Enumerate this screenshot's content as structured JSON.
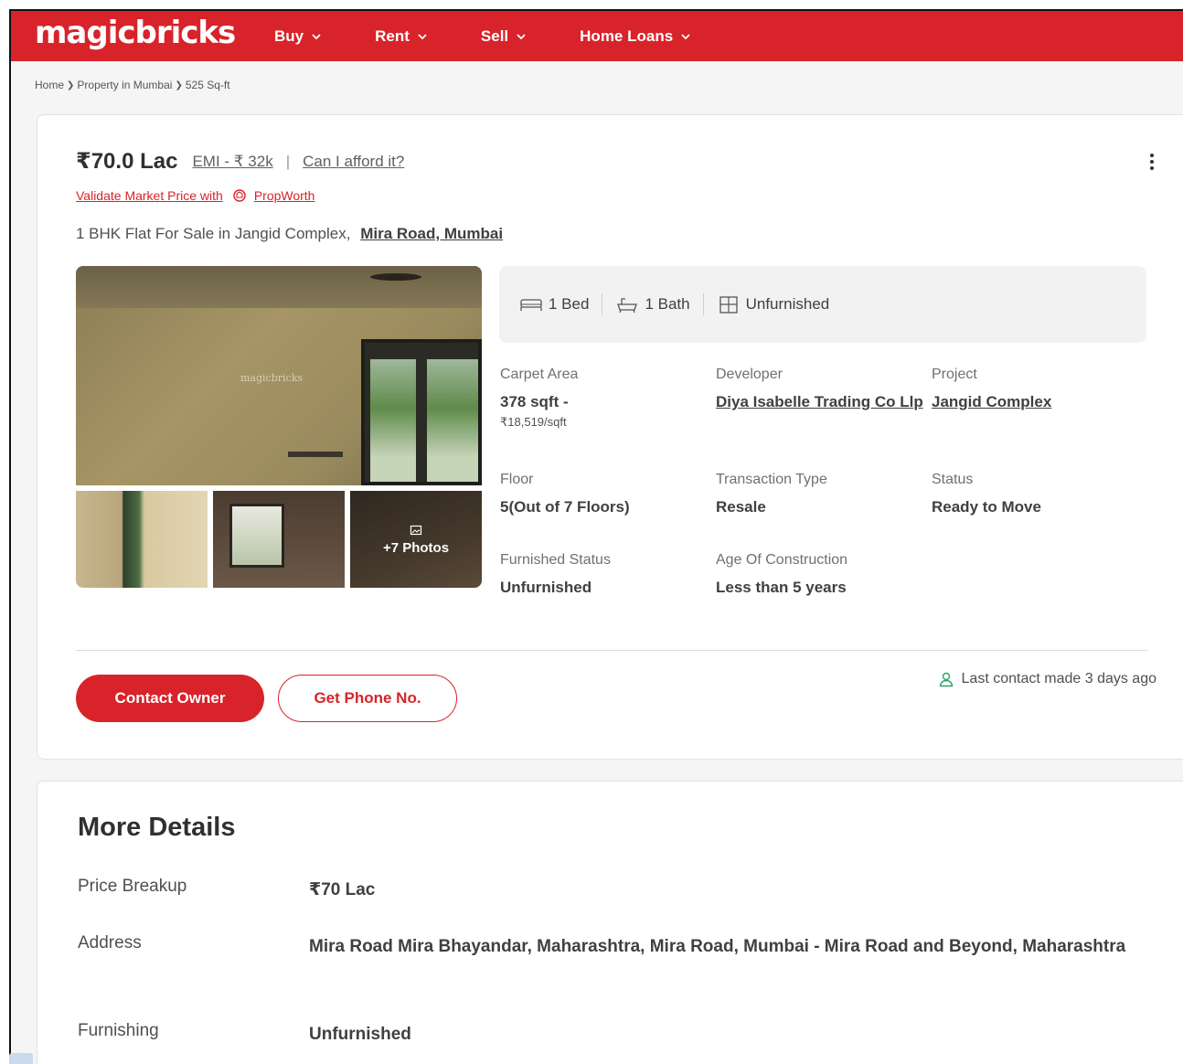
{
  "header": {
    "logo": "magicbricks",
    "nav": [
      {
        "label": "Buy"
      },
      {
        "label": "Rent"
      },
      {
        "label": "Sell"
      },
      {
        "label": "Home Loans"
      }
    ]
  },
  "breadcrumb": {
    "items": [
      "Home",
      "Property in Mumbai",
      "525 Sq-ft"
    ]
  },
  "listing": {
    "price": "₹70.0 Lac",
    "emi": "EMI - ₹ 32k",
    "afford": "Can I afford it?",
    "validate_text": "Validate Market Price with",
    "propworth": "PropWorth",
    "title": "1 BHK Flat For Sale in Jangid Complex,",
    "location": "Mira Road, Mumbai",
    "watermark": "magicbricks",
    "more_photos": "+7 Photos",
    "summary": {
      "bed": "1 Bed",
      "bath": "1 Bath",
      "furnishing": "Unfurnished"
    },
    "details": {
      "carpet_label": "Carpet Area",
      "carpet_value": "378 sqft -",
      "carpet_rate": "₹18,519/sqft",
      "developer_label": "Developer",
      "developer_value": "Diya Isabelle Trading Co Llp",
      "project_label": "Project",
      "project_value": "Jangid Complex",
      "floor_label": "Floor",
      "floor_value": "5(Out of 7 Floors)",
      "transaction_label": "Transaction Type",
      "transaction_value": "Resale",
      "status_label": "Status",
      "status_value": "Ready to Move",
      "furnished_label": "Furnished Status",
      "furnished_value": "Unfurnished",
      "age_label": "Age Of Construction",
      "age_value": "Less than 5 years"
    },
    "contact_button": "Contact Owner",
    "phone_button": "Get Phone No.",
    "last_contact": "Last contact made 3 days ago"
  },
  "more_details": {
    "title": "More Details",
    "rows": [
      {
        "key": "Price Breakup",
        "value": "₹70 Lac"
      },
      {
        "key": "Address",
        "value": "Mira Road Mira Bhayandar, Maharashtra, Mira Road, Mumbai - Mira Road and Beyond, Maharashtra"
      },
      {
        "key": "Furnishing",
        "value": "Unfurnished"
      }
    ]
  },
  "colors": {
    "brand_red": "#d8232a",
    "contact_green": "#2aa36b"
  }
}
